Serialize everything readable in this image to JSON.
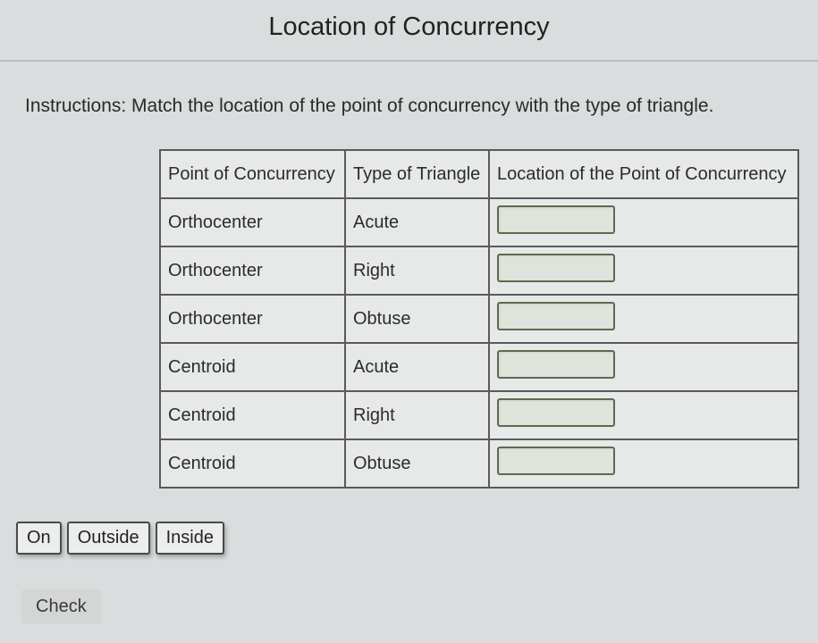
{
  "header": {
    "title": "Location of Concurrency"
  },
  "instructions": {
    "text": "Instructions: Match the location of the point of concurrency with the type of triangle."
  },
  "table": {
    "headers": {
      "c1": "Point of Concurrency",
      "c2": "Type of Triangle",
      "c3": "Location of the Point of Concurrency"
    },
    "rows": [
      {
        "point": "Orthocenter",
        "type": "Acute",
        "location": ""
      },
      {
        "point": "Orthocenter",
        "type": "Right",
        "location": ""
      },
      {
        "point": "Orthocenter",
        "type": "Obtuse",
        "location": ""
      },
      {
        "point": "Centroid",
        "type": "Acute",
        "location": ""
      },
      {
        "point": "Centroid",
        "type": "Right",
        "location": ""
      },
      {
        "point": "Centroid",
        "type": "Obtuse",
        "location": ""
      }
    ]
  },
  "chips": {
    "items": [
      {
        "label": "On"
      },
      {
        "label": "Outside"
      },
      {
        "label": "Inside"
      }
    ]
  },
  "buttons": {
    "check": "Check"
  }
}
